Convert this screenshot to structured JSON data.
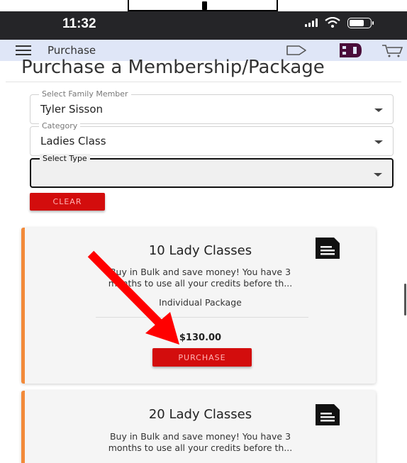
{
  "status_bar": {
    "time": "11:32"
  },
  "app_bar": {
    "title": "Purchase"
  },
  "page": {
    "title": "Purchase a Membership/Package"
  },
  "form": {
    "family_member": {
      "label": "Select Family Member",
      "value": "Tyler Sisson"
    },
    "category": {
      "label": "Category",
      "value": "Ladies Class"
    },
    "type": {
      "label": "Select Type",
      "value": ""
    },
    "clear_label": "CLEAR"
  },
  "packages": [
    {
      "title": "10 Lady Classes",
      "description_line1": "Buy in Bulk and save money! You have 3",
      "description_line2": "months to use all your credits before th...",
      "type": "Individual Package",
      "price": "$130.00",
      "purchase_label": "PURCHASE"
    },
    {
      "title": "20 Lady Classes",
      "description_line1": "Buy in Bulk and save money! You have 3",
      "description_line2": "months to use all your credits before th..."
    }
  ],
  "colors": {
    "accent_red": "#d30d0d",
    "card_border": "#f28a3a",
    "app_bar_bg": "#dfe6f7",
    "status_bar_bg": "#252528",
    "annotation_arrow": "#ff0000"
  },
  "icons": [
    "menu-icon",
    "tag-icon",
    "logo",
    "cart-icon",
    "document-icon"
  ]
}
